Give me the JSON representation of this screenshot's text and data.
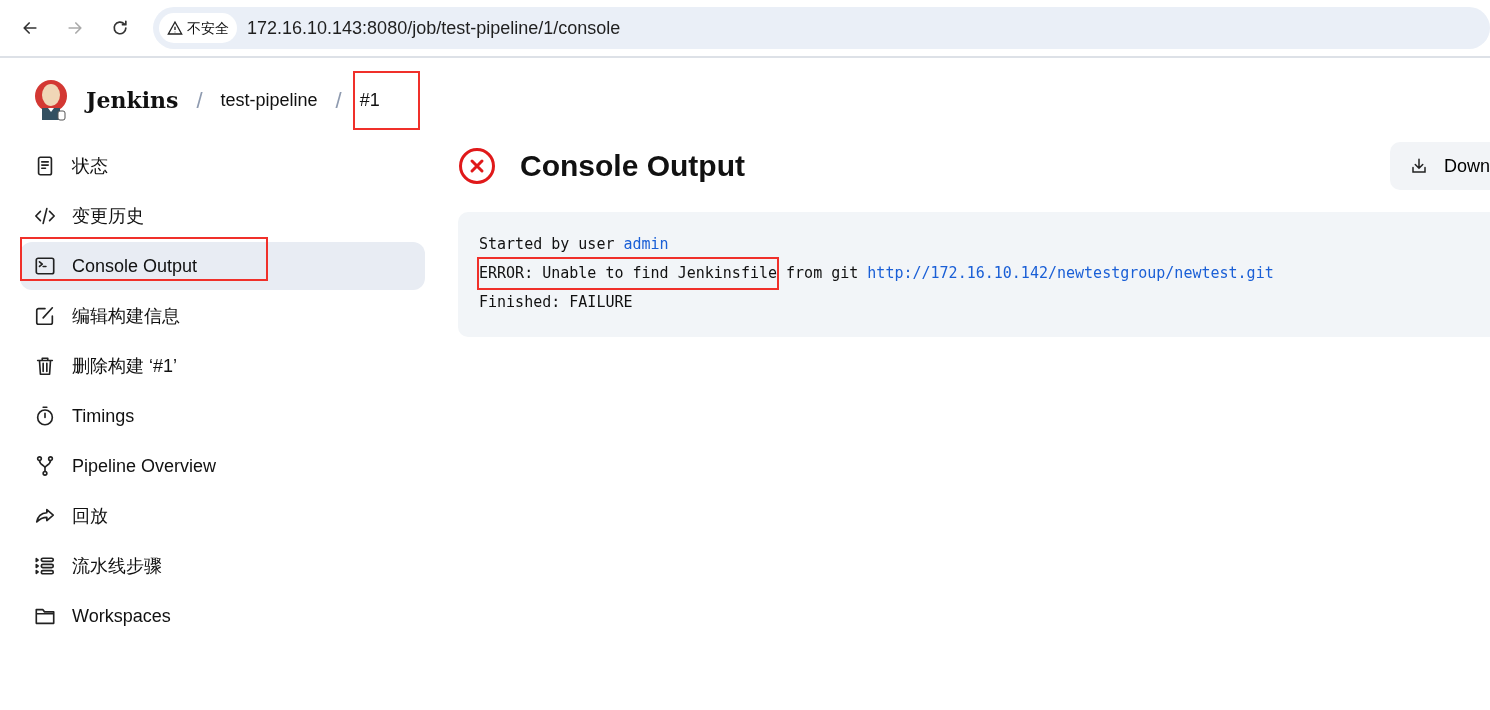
{
  "browser": {
    "security_label": "不安全",
    "url": "172.16.10.143:8080/job/test-pipeline/1/console"
  },
  "breadcrumbs": [
    {
      "label": "Jenkins",
      "kind": "brand",
      "highlighted": false
    },
    {
      "label": "/",
      "kind": "separator",
      "highlighted": false
    },
    {
      "label": "test-pipeline",
      "kind": "link",
      "highlighted": false
    },
    {
      "label": "/",
      "kind": "separator",
      "highlighted": false
    },
    {
      "label": "#1",
      "kind": "link",
      "highlighted": true
    }
  ],
  "sidebar": {
    "items": [
      {
        "label": "状态",
        "kind": "document",
        "selected": false,
        "highlighted": false
      },
      {
        "label": "变更历史",
        "kind": "code",
        "selected": false,
        "highlighted": false
      },
      {
        "label": "Console Output",
        "kind": "terminal",
        "selected": true,
        "highlighted": true
      },
      {
        "label": "编辑构建信息",
        "kind": "edit",
        "selected": false,
        "highlighted": false
      },
      {
        "label": "删除构建 ‘#1’",
        "kind": "trash",
        "selected": false,
        "highlighted": false
      },
      {
        "label": "Timings",
        "kind": "stopwatch",
        "selected": false,
        "highlighted": false
      },
      {
        "label": "Pipeline Overview",
        "kind": "branch",
        "selected": false,
        "highlighted": false
      },
      {
        "label": "回放",
        "kind": "redo",
        "selected": false,
        "highlighted": false
      },
      {
        "label": "流水线步骤",
        "kind": "steps",
        "selected": false,
        "highlighted": false
      },
      {
        "label": "Workspaces",
        "kind": "folder",
        "selected": false,
        "highlighted": false
      }
    ]
  },
  "page": {
    "title": "Console Output",
    "failed": true,
    "download_button": "Down"
  },
  "console": {
    "lines": [
      [
        {
          "text": "Started by user ",
          "kind": "text",
          "highlighted": false
        },
        {
          "text": "admin",
          "kind": "link",
          "highlighted": false
        }
      ],
      [
        {
          "text": "ERROR: Unable to find Jenkinsfile",
          "kind": "text",
          "highlighted": true
        },
        {
          "text": " from git ",
          "kind": "text",
          "highlighted": false
        },
        {
          "text": "http://172.16.10.142/newtestgroup/newtest.git",
          "kind": "link",
          "highlighted": false
        }
      ],
      [
        {
          "text": "Finished: FAILURE",
          "kind": "text",
          "highlighted": false
        }
      ]
    ]
  }
}
